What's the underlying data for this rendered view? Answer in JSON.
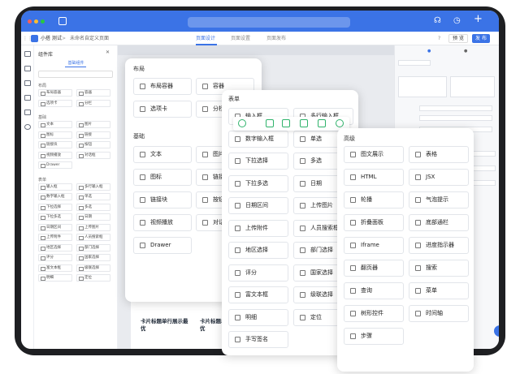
{
  "app": {
    "breadcrumb_app": "小搭 测试",
    "breadcrumb_sep": ">",
    "breadcrumb_page": "未命名自定义页面",
    "tabs": [
      "页面设计",
      "页面设置",
      "页面发布"
    ],
    "preview": "预 览",
    "publish": "发 布"
  },
  "library": {
    "title": "组件库",
    "tab": "基础组件",
    "groups": [
      {
        "name": "布局",
        "items": [
          "布局容器",
          "容器",
          "选项卡",
          "分栏"
        ]
      },
      {
        "name": "基础",
        "items": [
          "文本",
          "图片",
          "图标",
          "链接",
          "链接块",
          "按钮",
          "视频播放",
          "对话框",
          "Drawer"
        ]
      },
      {
        "name": "表单",
        "items": [
          "输入框",
          "多行输入框",
          "数字输入框",
          "单选",
          "下拉选择",
          "多选",
          "下拉多选",
          "日期",
          "日期区间",
          "上传图片",
          "上传附件",
          "人员搜索框",
          "地区选择",
          "部门选择",
          "评分",
          "国家选择",
          "富文本框",
          "级联选择",
          "明细",
          "定位"
        ]
      }
    ]
  },
  "layout_panel": {
    "title1": "布局",
    "row1": [
      "布局容器",
      "容器"
    ],
    "row2": [
      "选项卡",
      "分栏"
    ],
    "title2": "基础",
    "row3": [
      "文本",
      "图片"
    ],
    "row4": [
      "图标",
      "链接"
    ],
    "row5": [
      "链接块",
      "按钮"
    ],
    "row6": [
      "视频播放",
      "对话"
    ],
    "row7": [
      "Drawer"
    ]
  },
  "form_panel": {
    "title": "表单",
    "items": [
      "输入框",
      "多行输入框",
      "数字输入框",
      "单选",
      "下拉选择",
      "多选",
      "下拉多选",
      "日期",
      "日期区间",
      "上传图片",
      "上传附件",
      "人员搜索框",
      "地区选择",
      "部门选择",
      "评分",
      "国家选择",
      "富文本框",
      "级联选择",
      "明细",
      "定位",
      "手写签名"
    ]
  },
  "advanced_panel": {
    "title": "高级",
    "items": [
      "图文展示",
      "表格",
      "HTML",
      "JSX",
      "轮播",
      "气泡提示",
      "折叠面板",
      "底部通栏",
      "Iframe",
      "进度指示器",
      "翻页器",
      "搜索",
      "查询",
      "菜单",
      "树形控件",
      "时间轴",
      "步骤"
    ]
  },
  "cards": {
    "card1": "卡片标题单行展示最优",
    "card2": "卡片标题单行展示最优"
  },
  "colors": {
    "accent": "#3b73e6",
    "toolbar_icon": "#2fb36b"
  }
}
